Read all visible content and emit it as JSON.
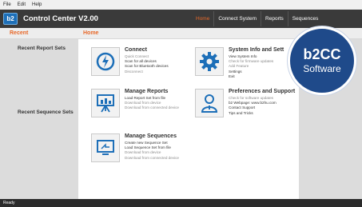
{
  "menu": [
    "File",
    "Edit",
    "Help"
  ],
  "app": {
    "logo_text": "b2",
    "title": "Control Center V2.00"
  },
  "nav": [
    {
      "label": "Home",
      "active": true
    },
    {
      "label": "Connect System",
      "active": false
    },
    {
      "label": "Reports",
      "active": false
    },
    {
      "label": "Sequences",
      "active": false
    }
  ],
  "sub": {
    "recent": "Recent",
    "home": "Home"
  },
  "sidebar": {
    "recent_reports": "Recent Report Sets",
    "recent_sequences": "Recent Sequence Sets"
  },
  "tiles": {
    "connect": {
      "title": "Connect",
      "icon": "power-icon",
      "links": [
        {
          "text": "Quick Connect",
          "enabled": false
        },
        {
          "text": "Scan for all devices",
          "enabled": true
        },
        {
          "text": "Scan for Bluetooth devices",
          "enabled": true
        },
        {
          "text": "Disconnect",
          "enabled": false
        }
      ]
    },
    "system": {
      "title": "System Info and Sett",
      "icon": "gear-icon",
      "links": [
        {
          "text": "View System Info",
          "enabled": true
        },
        {
          "text": "Check for firmware updates",
          "enabled": false
        },
        {
          "text": "Add Feature",
          "enabled": false
        },
        {
          "text": "Settings",
          "enabled": true
        },
        {
          "text": "Exit",
          "enabled": true
        }
      ]
    },
    "reports": {
      "title": "Manage Reports",
      "icon": "report-board-icon",
      "links": [
        {
          "text": "Load Report Set from file",
          "enabled": true
        },
        {
          "text": "Download from device",
          "enabled": false
        },
        {
          "text": "Download from connected device",
          "enabled": false
        }
      ]
    },
    "prefs": {
      "title": "Preferences and Support",
      "icon": "person-support-icon",
      "links": [
        {
          "text": "Check for software updates",
          "enabled": false
        },
        {
          "text": "b2 Webpage: www.b2hu.com",
          "enabled": true
        },
        {
          "text": "Contact Support",
          "enabled": true
        },
        {
          "text": "Tips and Tricks",
          "enabled": true
        }
      ]
    },
    "sequences": {
      "title": "Manage Sequences",
      "icon": "monitor-sequence-icon",
      "links": [
        {
          "text": "Create new Sequence Set",
          "enabled": true
        },
        {
          "text": "Load Sequence Set from file",
          "enabled": true
        },
        {
          "text": "Download from device",
          "enabled": false
        },
        {
          "text": "Download from connected device",
          "enabled": false
        }
      ]
    }
  },
  "badge": {
    "line1": "b2CC",
    "line2": "Software"
  },
  "status": {
    "text": "Ready"
  },
  "colors": {
    "accent": "#e8692a",
    "brand_blue": "#1d6fb8",
    "badge_blue": "#1f4a8a"
  }
}
